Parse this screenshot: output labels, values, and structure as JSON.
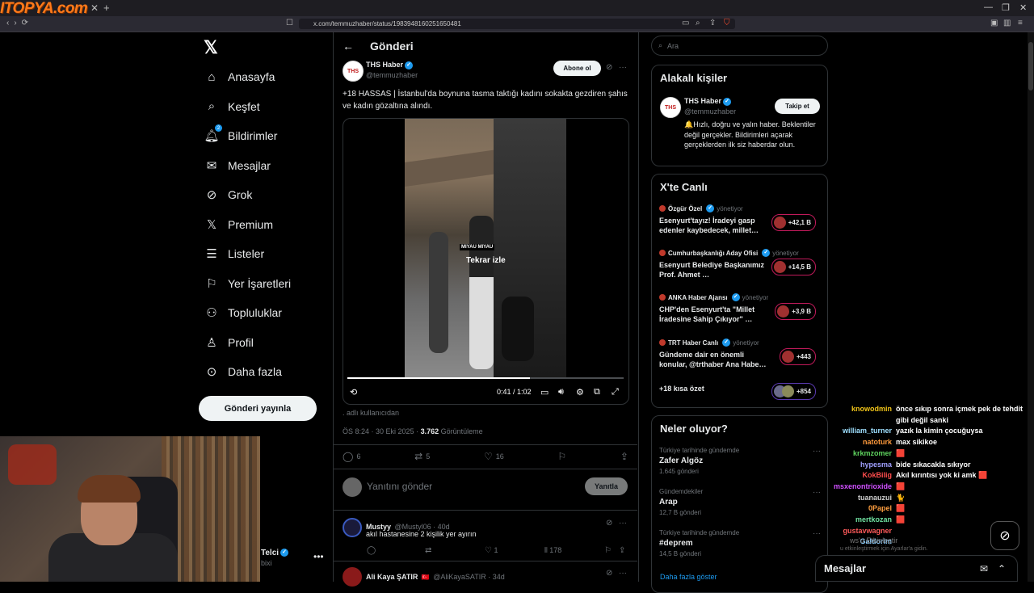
{
  "browser": {
    "overlay_logo": "ITOPYA.com",
    "url": "x.com/temmuzhaber/status/1983948160251650481"
  },
  "nav": {
    "items": [
      {
        "label": "Anasayfa",
        "icon": "home-icon"
      },
      {
        "label": "Keşfet",
        "icon": "search-icon"
      },
      {
        "label": "Bildirimler",
        "icon": "bell-icon",
        "badge": "2"
      },
      {
        "label": "Mesajlar",
        "icon": "mail-icon"
      },
      {
        "label": "Grok",
        "icon": "grok-icon"
      },
      {
        "label": "Premium",
        "icon": "x-premium-icon"
      },
      {
        "label": "Listeler",
        "icon": "list-icon"
      },
      {
        "label": "Yer İşaretleri",
        "icon": "bookmark-icon"
      },
      {
        "label": "Topluluklar",
        "icon": "communities-icon"
      },
      {
        "label": "Profil",
        "icon": "profile-icon"
      },
      {
        "label": "Daha fazla",
        "icon": "more-circle-icon"
      }
    ],
    "post_button": "Gönderi yayınla",
    "profile_name": "Telci",
    "profile_handle": "bixi"
  },
  "header": {
    "title": "Gönderi"
  },
  "tweet": {
    "author": "THS Haber",
    "handle": "@temmuzhaber",
    "avatar_text": "THS",
    "follow": "Abone ol",
    "text": "+18 HASSAS | İstanbul'da boynuna tasma taktığı kadını sokakta gezdiren şahıs ve kadın gözaltına alındı.",
    "video": {
      "overlay": "Tekrar izle",
      "caption": "MIYAU MIYAU",
      "time": "0:41 / 1:02",
      "progress": 0.66
    },
    "from_user": ". adlı kullanıcıdan",
    "timestamp": "ÖS 8:24 · 30 Eki 2025 · ",
    "views": "3.762",
    "views_label": " Görüntüleme",
    "replies": "6",
    "retweets": "5",
    "likes": "16"
  },
  "reply_box": {
    "placeholder": "Yanıtını gönder",
    "button": "Yanıtla"
  },
  "comments": [
    {
      "name": "Mustyy",
      "handle": "@Mustyl06 · 40d",
      "text": "akıl hastanesine 2 kişilik yer ayırın",
      "replies": "",
      "retweets": "",
      "likes": "1",
      "views": "178"
    },
    {
      "name": "Ali Kaya ŞATIR",
      "flag": "🇹🇷",
      "handle": "@AliKayaSATIR · 34d",
      "text": ""
    }
  ],
  "right": {
    "search_placeholder": "Ara",
    "related_title": "Alakalı kişiler",
    "related": {
      "name": "THS Haber",
      "handle": "@temmuzhaber",
      "follow": "Takip et",
      "bio": "🔔Hızlı, doğru ve yalın haber. Beklentiler değil gerçekler. Bildirimleri açarak gerçeklerden ilk siz haberdar olun."
    },
    "live_title": "X'te Canlı",
    "live": [
      {
        "host": "Özgür Özel",
        "role": "yönetiyor",
        "title": "Esenyurt'tayız! İradeyi gasp edenler kaybedecek, millet…",
        "count": "+42,1 B"
      },
      {
        "host": "Cumhurbaşkanlığı Aday Ofisi",
        "role": "yönetiyor",
        "title": "Esenyurt Belediye Başkanımız Prof. Ahmet …",
        "count": "+14,5 B"
      },
      {
        "host": "ANKA Haber Ajansı",
        "role": "yönetiyor",
        "title": "CHP'den Esenyurt'ta \"Millet İradesine Sahip Çıkıyor\" …",
        "count": "+3,9 B"
      },
      {
        "host": "TRT Haber Canlı",
        "role": "yönetiyor",
        "title": "Gündeme dair en önemli konular, @trthaber Ana Habe…",
        "count": "+443"
      }
    ],
    "live_more": "+18 kısa özet",
    "live_more_count": "+854",
    "trends_title": "Neler oluyor?",
    "trends": [
      {
        "category": "Türkiye tarihinde gündemde",
        "name": "Zafer Algöz",
        "count": "1.645 gönderi"
      },
      {
        "category": "Gündemdekiler",
        "name": "Arap",
        "count": "12,7 B gönderi"
      },
      {
        "category": "Türkiye tarihinde gündemde",
        "name": "#deprem",
        "count": "14,5 B gönderi"
      }
    ],
    "show_more": "Daha fazla göster"
  },
  "chat": [
    {
      "user": "",
      "msg": "",
      "color": "#e7e9ea"
    },
    {
      "user": "knowodmin",
      "msg": "önce sıkıp sonra içmek pek de tehdit",
      "color": "#f0c419"
    },
    {
      "user": "",
      "msg": "gibi değil sanki",
      "color": "#f0c419"
    },
    {
      "user": "william_turner",
      "msg": "yazık la kimin çocuğuysa",
      "color": "#9fe0ff"
    },
    {
      "user": "natoturk",
      "msg": "max sikikoe",
      "color": "#ff9a3c"
    },
    {
      "user": "krkmzomer",
      "msg": "🟥",
      "color": "#5fd35f"
    },
    {
      "user": "hypesma",
      "msg": "bide sıkacakla sıkıyor",
      "color": "#a0a0ff"
    },
    {
      "user": "KokBilig",
      "msg": "Akıl kırıntısı yok ki amk 🟥",
      "color": "#ff4d4d"
    },
    {
      "user": "msxenontrioxide",
      "msg": "🟥",
      "color": "#d050ff"
    },
    {
      "user": "tuanauzui",
      "msg": "🐈",
      "color": "#d0d0d0"
    },
    {
      "user": "0Papel",
      "msg": "🟥",
      "color": "#ff9f40"
    },
    {
      "user": "mertkozan",
      "msg": "🟥",
      "color": "#6fe0a0"
    },
    {
      "user": "gustavwagner",
      "msg": "",
      "color": "#ff5a5a"
    },
    {
      "user": "Galdorim",
      "msg": "",
      "color": "#8fd0ff"
    }
  ],
  "windows_activation": {
    "line1": "ws'u Etkinleştir",
    "line2": "u etkinleştirmek için Ayarlar'a gidin."
  },
  "messages_bar": {
    "title": "Mesajlar"
  },
  "colors": {
    "accent": "#1d9bf0",
    "background": "#000000",
    "border": "#2f3336",
    "live_pill": "#c01a5a"
  }
}
